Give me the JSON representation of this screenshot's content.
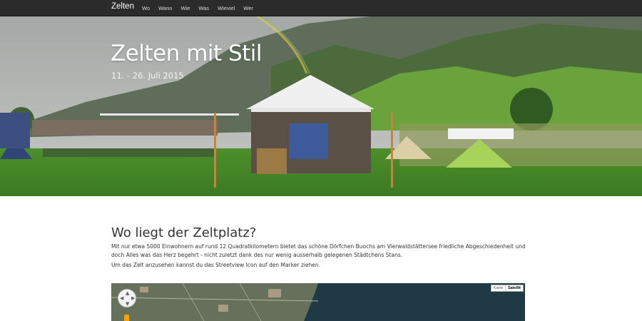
{
  "navbar": {
    "brand": "Zelten",
    "items": [
      "Wo",
      "Wann",
      "Wie",
      "Was",
      "Wieviel",
      "Wer"
    ]
  },
  "hero": {
    "title": "Zelten mit Stil",
    "date": "11. - 26. Juli 2015"
  },
  "section": {
    "title": "Wo liegt der Zeltplatz?",
    "paragraph1": "Mit nur etwa 5000 Einwohnern auf rund 12 Quadratkilometern bietet das schöne Dörfchen Buochs am Vierwaldstättersee friedliche Abgeschiedenheit und doch Alles was das Herz begehrt - nicht zuletzt dank des nur wenig ausserhalb gelegenen Städtchens Stans.",
    "paragraph2": "Um das Zelt anzusehen kannst du das Streetview Icon auf den Marker ziehen."
  },
  "map": {
    "type_map": "Karte",
    "type_satellite": "Satellit",
    "active_type": "Satellit"
  },
  "colors": {
    "navbar_bg": "#2b2b2b",
    "grass": "#4f9a2a",
    "lake": "#1f3a44"
  }
}
